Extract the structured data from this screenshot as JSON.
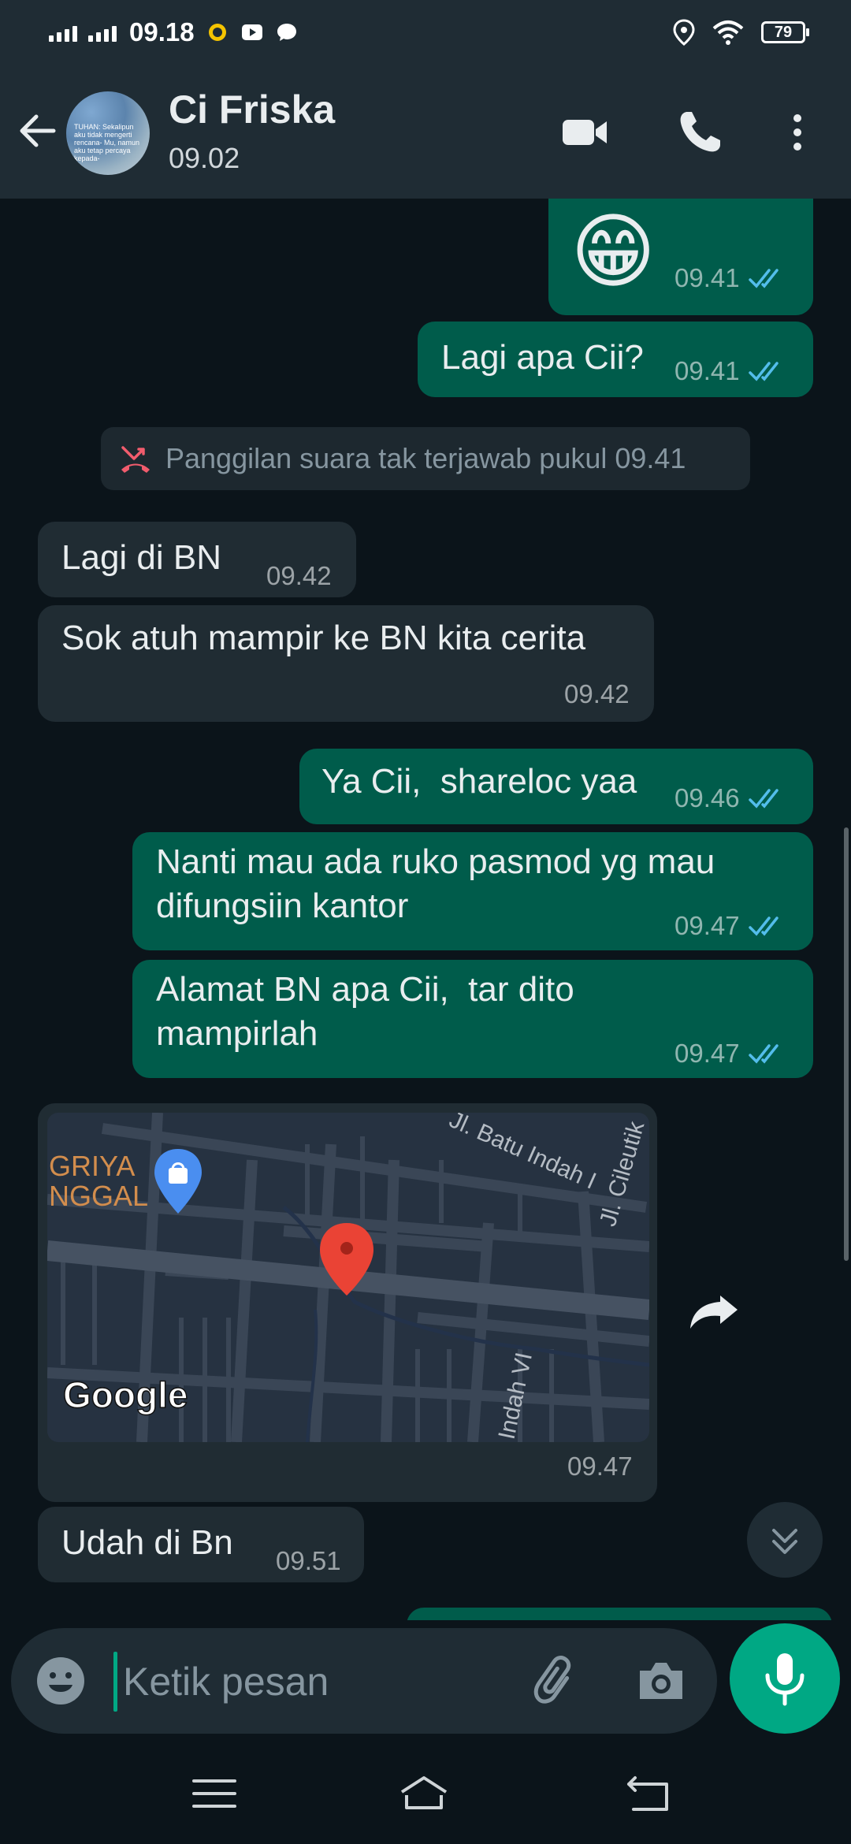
{
  "status_bar": {
    "time": "09.18",
    "battery": "79"
  },
  "header": {
    "contact_name": "Ci Friska",
    "last_seen": "09.02",
    "avatar_text": "TUHAN: Sekalipun aku tidak mengerti rencana- Mu, namun aku tetap percaya kepada-"
  },
  "messages": [
    {
      "direction": "out",
      "text": "😁",
      "time": "09.41",
      "status": "read"
    },
    {
      "direction": "out",
      "text": "Lagi apa Cii?",
      "time": "09.41",
      "status": "read"
    },
    {
      "direction": "system",
      "text": "Panggilan suara tak terjawab pukul 09.41"
    },
    {
      "direction": "in",
      "text": "Lagi di BN",
      "time": "09.42"
    },
    {
      "direction": "in",
      "text": "Sok atuh mampir ke BN kita cerita",
      "time": "09.42"
    },
    {
      "direction": "out",
      "text": "Ya Cii,  shareloc yaa",
      "time": "09.46",
      "status": "read"
    },
    {
      "direction": "out",
      "text": "Nanti mau ada ruko pasmod yg mau difungsiin kantor",
      "line1": "Nanti mau ada ruko pasmod yg mau",
      "line2": "difungsiin kantor",
      "time": "09.47",
      "status": "read"
    },
    {
      "direction": "out",
      "text": "Alamat BN apa Cii,  tar dito mampirlah",
      "line1": "Alamat BN apa Cii,  tar dito",
      "line2": "mampirlah",
      "time": "09.47",
      "status": "read"
    },
    {
      "direction": "in",
      "type": "location",
      "time": "09.47",
      "map_labels": {
        "place_1": "GRIYA",
        "place_2": "NGGAL",
        "street_1": "Jl. Batu Indah I",
        "street_2": "Jl. Cileutik",
        "street_3": "Indah VI",
        "provider": "Google"
      }
    },
    {
      "direction": "in",
      "text": "Udah di Bn",
      "time": "09.51"
    }
  ],
  "input": {
    "placeholder": "Ketik pesan"
  },
  "colors": {
    "outgoing_bubble": "#005c4b",
    "incoming_bubble": "#202c33",
    "accent": "#00a884",
    "read_ticks": "#53bdeb",
    "background": "#0b141a"
  },
  "icons": [
    "back-arrow-icon",
    "video-call-icon",
    "voice-call-icon",
    "more-options-icon",
    "missed-call-icon",
    "forward-icon",
    "scroll-down-icon",
    "emoji-icon",
    "attach-icon",
    "camera-icon",
    "mic-icon",
    "menu-icon",
    "home-icon",
    "back-nav-icon"
  ]
}
